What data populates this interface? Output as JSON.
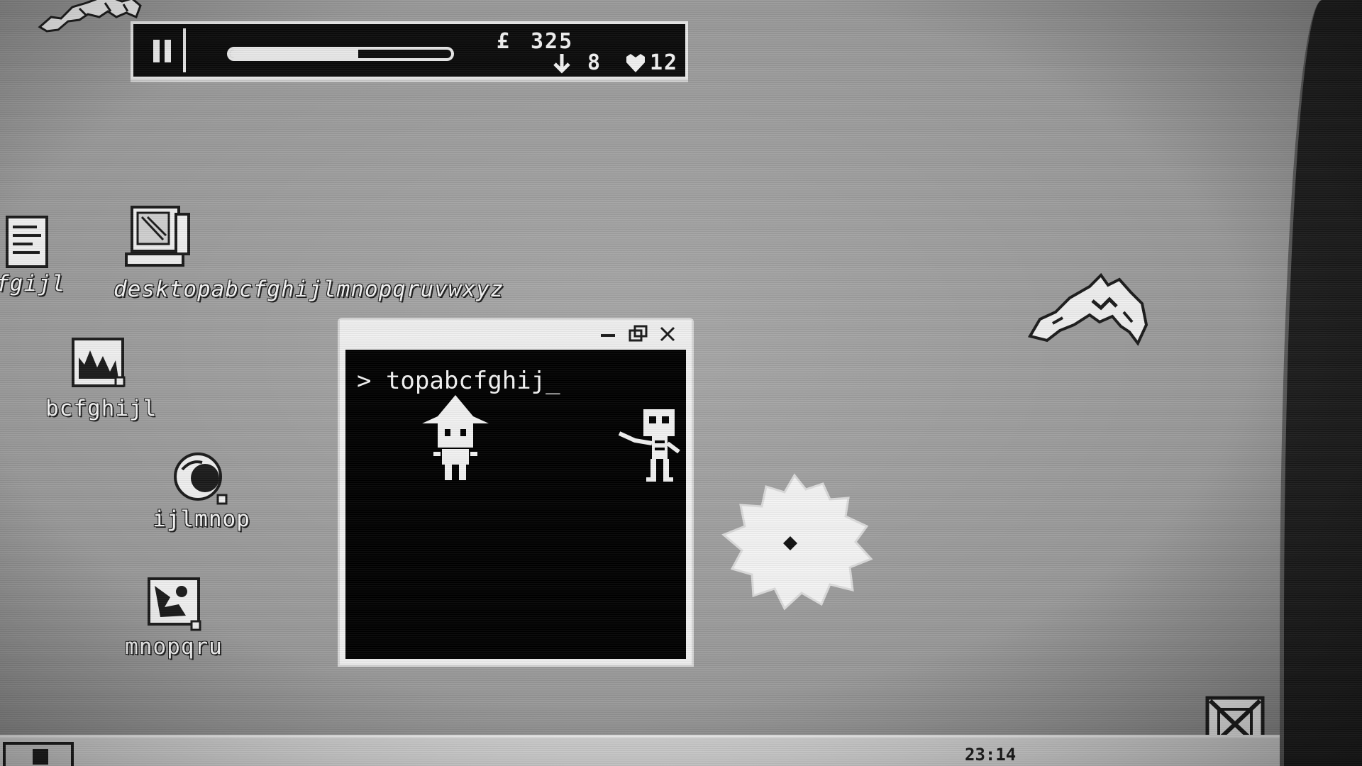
{
  "hud": {
    "pause_icon": "pause-icon",
    "progress_fraction": 0.58,
    "currency_symbol": "£",
    "currency": "325",
    "arrows_icon": "arrow-down-icon",
    "arrows": "8",
    "hearts_icon": "heart-icon",
    "hearts": "12"
  },
  "desktop": {
    "icons": [
      {
        "label": "fgijl",
        "icon": "document-icon"
      },
      {
        "label": "desktopabcfghijlmnopqruvwxyz",
        "icon": "computer-icon"
      },
      {
        "label": "bcfghijl",
        "icon": "image-icon"
      },
      {
        "label": "ijlmnop",
        "icon": "globe-icon"
      },
      {
        "label": "mnopqru",
        "icon": "picture-icon"
      }
    ]
  },
  "window": {
    "prompt": "> topabcfghij_",
    "controls": [
      "minimize-icon",
      "restore-icon",
      "close-icon"
    ]
  },
  "taskbar": {
    "clock": "23:14"
  },
  "colors": {
    "desktop": "#9e9e9e",
    "terminal_bg": "#000000",
    "foreground": "#f0f0f0"
  }
}
